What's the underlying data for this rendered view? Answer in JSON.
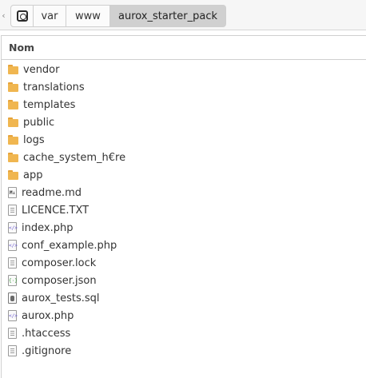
{
  "pathbar": {
    "home_icon": "drive-icon",
    "crumbs": [
      {
        "label": "var"
      },
      {
        "label": "www"
      },
      {
        "label": "aurox_starter_pack"
      }
    ]
  },
  "list": {
    "column_header": "Nom",
    "items": [
      {
        "name": "vendor",
        "icon": "folder-icon"
      },
      {
        "name": "translations",
        "icon": "folder-icon"
      },
      {
        "name": "templates",
        "icon": "folder-icon"
      },
      {
        "name": "public",
        "icon": "folder-icon"
      },
      {
        "name": "logs",
        "icon": "folder-icon"
      },
      {
        "name": "cache_system_h€re",
        "icon": "folder-icon"
      },
      {
        "name": "app",
        "icon": "folder-icon"
      },
      {
        "name": "readme.md",
        "icon": "markdown-file-icon"
      },
      {
        "name": "LICENCE.TXT",
        "icon": "text-file-icon"
      },
      {
        "name": "index.php",
        "icon": "php-file-icon"
      },
      {
        "name": "conf_example.php",
        "icon": "php-file-icon"
      },
      {
        "name": "composer.lock",
        "icon": "text-file-icon"
      },
      {
        "name": "composer.json",
        "icon": "json-file-icon"
      },
      {
        "name": "aurox_tests.sql",
        "icon": "sql-file-icon"
      },
      {
        "name": "aurox.php",
        "icon": "php-file-icon"
      },
      {
        "name": ".htaccess",
        "icon": "text-file-icon"
      },
      {
        "name": ".gitignore",
        "icon": "text-file-icon"
      }
    ]
  },
  "colors": {
    "folder": "#f0b650",
    "active_crumb_bg": "#d0d0d0"
  }
}
